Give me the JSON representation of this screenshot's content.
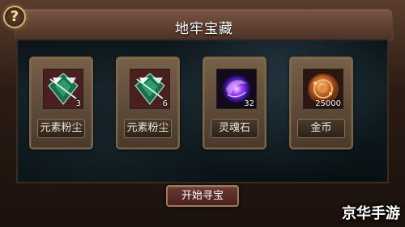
{
  "dialog": {
    "title": "地牢宝藏",
    "help_label": "?",
    "items": [
      {
        "name": "元素粉尘",
        "count": "3",
        "icon": "element-dust-icon"
      },
      {
        "name": "元素粉尘",
        "count": "6",
        "icon": "element-dust-icon"
      },
      {
        "name": "灵魂石",
        "count": "32",
        "icon": "soul-stone-icon"
      },
      {
        "name": "金币",
        "count": "25000",
        "icon": "gold-coin-icon"
      }
    ],
    "start_button": "开始寻宝"
  },
  "watermark": "京华手游",
  "colors": {
    "accent_gold": "#d8b46a",
    "title_bar": "#7a5442",
    "button_red": "#6e3a35"
  }
}
